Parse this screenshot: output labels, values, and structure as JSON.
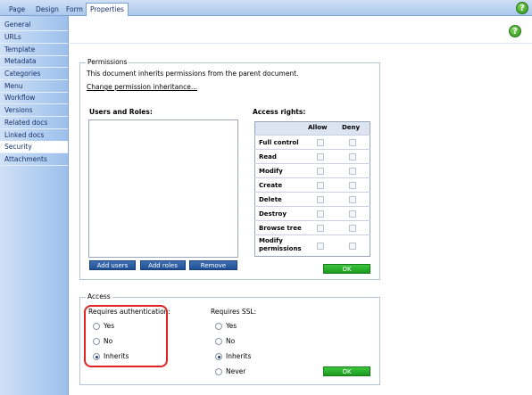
{
  "tabs": [
    {
      "label": "Page"
    },
    {
      "label": "Design"
    },
    {
      "label": "Form"
    },
    {
      "label": "Properties"
    }
  ],
  "help": {
    "glyph": "?"
  },
  "sidebar": {
    "items": [
      {
        "label": "General"
      },
      {
        "label": "URLs"
      },
      {
        "label": "Template"
      },
      {
        "label": "Metadata"
      },
      {
        "label": "Categories"
      },
      {
        "label": "Menu"
      },
      {
        "label": "Workflow"
      },
      {
        "label": "Versions"
      },
      {
        "label": "Related docs"
      },
      {
        "label": "Linked docs"
      },
      {
        "label": "Security"
      },
      {
        "label": "Attachments"
      }
    ]
  },
  "permissions": {
    "legend": "Permissions",
    "inherit_text": "This document inherits permissions from the parent document.",
    "change_link": "Change permission inheritance...",
    "users_roles_label": "Users and Roles:",
    "access_rights_label": "Access rights:",
    "buttons": {
      "add_users": "Add users",
      "add_roles": "Add roles",
      "remove": "Remove",
      "ok": "OK"
    },
    "columns": {
      "allow": "Allow",
      "deny": "Deny"
    },
    "rights": [
      {
        "label": "Full control"
      },
      {
        "label": "Read"
      },
      {
        "label": "Modify"
      },
      {
        "label": "Create"
      },
      {
        "label": "Delete"
      },
      {
        "label": "Destroy"
      },
      {
        "label": "Browse tree"
      },
      {
        "label": "Modify",
        "label2": "permissions"
      }
    ]
  },
  "access": {
    "legend": "Access",
    "requires_auth_label": "Requires authentication:",
    "requires_ssl_label": "Requires SSL:",
    "auth_options": [
      {
        "label": "Yes",
        "checked": false
      },
      {
        "label": "No",
        "checked": false
      },
      {
        "label": "Inherits",
        "checked": true
      }
    ],
    "ssl_options": [
      {
        "label": "Yes",
        "checked": false
      },
      {
        "label": "No",
        "checked": false
      },
      {
        "label": "Inherits",
        "checked": true
      },
      {
        "label": "Never",
        "checked": false
      }
    ],
    "ok": "OK"
  },
  "colors": {
    "accent": "#1f4f94",
    "ok_green": "#1c9a1e",
    "highlight": "#e02424"
  }
}
